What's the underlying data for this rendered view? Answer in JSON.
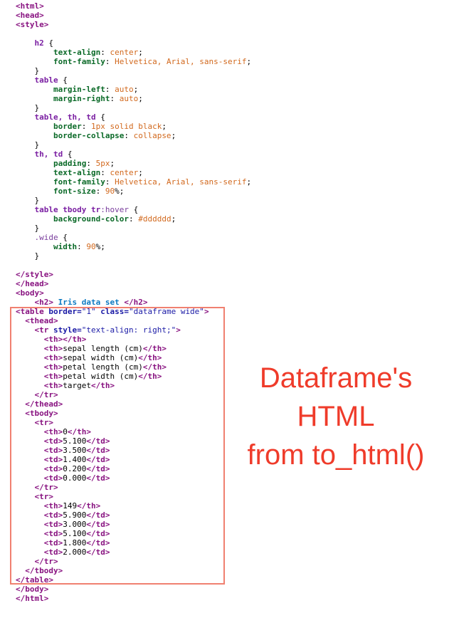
{
  "code_lines": [
    [
      {
        "t": "tag",
        "v": "<html>"
      }
    ],
    [
      {
        "t": "tag",
        "v": "<head>"
      }
    ],
    [
      {
        "t": "tag",
        "v": "<style>"
      }
    ],
    [],
    [
      {
        "t": "text",
        "v": "    "
      },
      {
        "t": "sel",
        "v": "h2"
      },
      {
        "t": "text",
        "v": " {"
      }
    ],
    [
      {
        "t": "text",
        "v": "        "
      },
      {
        "t": "prop",
        "v": "text-align"
      },
      {
        "t": "text",
        "v": ": "
      },
      {
        "t": "val",
        "v": "center"
      },
      {
        "t": "text",
        "v": ";"
      }
    ],
    [
      {
        "t": "text",
        "v": "        "
      },
      {
        "t": "prop",
        "v": "font-family"
      },
      {
        "t": "text",
        "v": ": "
      },
      {
        "t": "val",
        "v": "Helvetica, Arial, sans-serif"
      },
      {
        "t": "text",
        "v": ";"
      }
    ],
    [
      {
        "t": "text",
        "v": "    }"
      }
    ],
    [
      {
        "t": "text",
        "v": "    "
      },
      {
        "t": "sel",
        "v": "table"
      },
      {
        "t": "text",
        "v": " {"
      }
    ],
    [
      {
        "t": "text",
        "v": "        "
      },
      {
        "t": "prop",
        "v": "margin-left"
      },
      {
        "t": "text",
        "v": ": "
      },
      {
        "t": "val",
        "v": "auto"
      },
      {
        "t": "text",
        "v": ";"
      }
    ],
    [
      {
        "t": "text",
        "v": "        "
      },
      {
        "t": "prop",
        "v": "margin-right"
      },
      {
        "t": "text",
        "v": ": "
      },
      {
        "t": "val",
        "v": "auto"
      },
      {
        "t": "text",
        "v": ";"
      }
    ],
    [
      {
        "t": "text",
        "v": "    }"
      }
    ],
    [
      {
        "t": "text",
        "v": "    "
      },
      {
        "t": "sel",
        "v": "table, th, td"
      },
      {
        "t": "text",
        "v": " {"
      }
    ],
    [
      {
        "t": "text",
        "v": "        "
      },
      {
        "t": "prop",
        "v": "border"
      },
      {
        "t": "text",
        "v": ": "
      },
      {
        "t": "val",
        "v": "1px solid black"
      },
      {
        "t": "text",
        "v": ";"
      }
    ],
    [
      {
        "t": "text",
        "v": "        "
      },
      {
        "t": "prop",
        "v": "border-collapse"
      },
      {
        "t": "text",
        "v": ": "
      },
      {
        "t": "val",
        "v": "collapse"
      },
      {
        "t": "text",
        "v": ";"
      }
    ],
    [
      {
        "t": "text",
        "v": "    }"
      }
    ],
    [
      {
        "t": "text",
        "v": "    "
      },
      {
        "t": "sel",
        "v": "th, td"
      },
      {
        "t": "text",
        "v": " {"
      }
    ],
    [
      {
        "t": "text",
        "v": "        "
      },
      {
        "t": "prop",
        "v": "padding"
      },
      {
        "t": "text",
        "v": ": "
      },
      {
        "t": "val",
        "v": "5px"
      },
      {
        "t": "text",
        "v": ";"
      }
    ],
    [
      {
        "t": "text",
        "v": "        "
      },
      {
        "t": "prop",
        "v": "text-align"
      },
      {
        "t": "text",
        "v": ": "
      },
      {
        "t": "val",
        "v": "center"
      },
      {
        "t": "text",
        "v": ";"
      }
    ],
    [
      {
        "t": "text",
        "v": "        "
      },
      {
        "t": "prop",
        "v": "font-family"
      },
      {
        "t": "text",
        "v": ": "
      },
      {
        "t": "val",
        "v": "Helvetica, Arial, sans-serif"
      },
      {
        "t": "text",
        "v": ";"
      }
    ],
    [
      {
        "t": "text",
        "v": "        "
      },
      {
        "t": "prop",
        "v": "font-size"
      },
      {
        "t": "text",
        "v": ": "
      },
      {
        "t": "val",
        "v": "90"
      },
      {
        "t": "text",
        "v": "%;"
      }
    ],
    [
      {
        "t": "text",
        "v": "    }"
      }
    ],
    [
      {
        "t": "text",
        "v": "    "
      },
      {
        "t": "sel",
        "v": "table tbody tr"
      },
      {
        "t": "pseudo",
        "v": ":hover"
      },
      {
        "t": "text",
        "v": " {"
      }
    ],
    [
      {
        "t": "text",
        "v": "        "
      },
      {
        "t": "prop",
        "v": "background-color"
      },
      {
        "t": "text",
        "v": ": "
      },
      {
        "t": "val",
        "v": "#dddddd"
      },
      {
        "t": "text",
        "v": ";"
      }
    ],
    [
      {
        "t": "text",
        "v": "    }"
      }
    ],
    [
      {
        "t": "text",
        "v": "    "
      },
      {
        "t": "pseudo",
        "v": ".wide"
      },
      {
        "t": "text",
        "v": " {"
      }
    ],
    [
      {
        "t": "text",
        "v": "        "
      },
      {
        "t": "prop",
        "v": "width"
      },
      {
        "t": "text",
        "v": ": "
      },
      {
        "t": "val",
        "v": "90"
      },
      {
        "t": "text",
        "v": "%;"
      }
    ],
    [
      {
        "t": "text",
        "v": "    }"
      }
    ],
    [],
    [
      {
        "t": "tag",
        "v": "</style>"
      }
    ],
    [
      {
        "t": "tag",
        "v": "</head>"
      }
    ],
    [
      {
        "t": "tag",
        "v": "<body>"
      }
    ],
    [
      {
        "t": "text",
        "v": "    "
      },
      {
        "t": "tag",
        "v": "<h2>"
      },
      {
        "t": "title",
        "v": " Iris data set "
      },
      {
        "t": "tag",
        "v": "</h2>"
      }
    ],
    [
      {
        "t": "tag",
        "v": "<table "
      },
      {
        "t": "attr",
        "v": "border="
      },
      {
        "t": "str",
        "v": "\"1\""
      },
      {
        "t": "text",
        "v": " "
      },
      {
        "t": "attr",
        "v": "class="
      },
      {
        "t": "str",
        "v": "\"dataframe wide\""
      },
      {
        "t": "tag",
        "v": ">"
      }
    ],
    [
      {
        "t": "text",
        "v": "  "
      },
      {
        "t": "tag",
        "v": "<thead>"
      }
    ],
    [
      {
        "t": "text",
        "v": "    "
      },
      {
        "t": "tag",
        "v": "<tr "
      },
      {
        "t": "attr",
        "v": "style="
      },
      {
        "t": "str",
        "v": "\"text-align: right;\""
      },
      {
        "t": "tag",
        "v": ">"
      }
    ],
    [
      {
        "t": "text",
        "v": "      "
      },
      {
        "t": "tag",
        "v": "<th></th>"
      }
    ],
    [
      {
        "t": "text",
        "v": "      "
      },
      {
        "t": "tag",
        "v": "<th>"
      },
      {
        "t": "text",
        "v": "sepal length (cm)"
      },
      {
        "t": "tag",
        "v": "</th>"
      }
    ],
    [
      {
        "t": "text",
        "v": "      "
      },
      {
        "t": "tag",
        "v": "<th>"
      },
      {
        "t": "text",
        "v": "sepal width (cm)"
      },
      {
        "t": "tag",
        "v": "</th>"
      }
    ],
    [
      {
        "t": "text",
        "v": "      "
      },
      {
        "t": "tag",
        "v": "<th>"
      },
      {
        "t": "text",
        "v": "petal length (cm)"
      },
      {
        "t": "tag",
        "v": "</th>"
      }
    ],
    [
      {
        "t": "text",
        "v": "      "
      },
      {
        "t": "tag",
        "v": "<th>"
      },
      {
        "t": "text",
        "v": "petal width (cm)"
      },
      {
        "t": "tag",
        "v": "</th>"
      }
    ],
    [
      {
        "t": "text",
        "v": "      "
      },
      {
        "t": "tag",
        "v": "<th>"
      },
      {
        "t": "text",
        "v": "target"
      },
      {
        "t": "tag",
        "v": "</th>"
      }
    ],
    [
      {
        "t": "text",
        "v": "    "
      },
      {
        "t": "tag",
        "v": "</tr>"
      }
    ],
    [
      {
        "t": "text",
        "v": "  "
      },
      {
        "t": "tag",
        "v": "</thead>"
      }
    ],
    [
      {
        "t": "text",
        "v": "  "
      },
      {
        "t": "tag",
        "v": "<tbody>"
      }
    ],
    [
      {
        "t": "text",
        "v": "    "
      },
      {
        "t": "tag",
        "v": "<tr>"
      }
    ],
    [
      {
        "t": "text",
        "v": "      "
      },
      {
        "t": "tag",
        "v": "<th>"
      },
      {
        "t": "text",
        "v": "0"
      },
      {
        "t": "tag",
        "v": "</th>"
      }
    ],
    [
      {
        "t": "text",
        "v": "      "
      },
      {
        "t": "tag",
        "v": "<td>"
      },
      {
        "t": "text",
        "v": "5.100"
      },
      {
        "t": "tag",
        "v": "</td>"
      }
    ],
    [
      {
        "t": "text",
        "v": "      "
      },
      {
        "t": "tag",
        "v": "<td>"
      },
      {
        "t": "text",
        "v": "3.500"
      },
      {
        "t": "tag",
        "v": "</td>"
      }
    ],
    [
      {
        "t": "text",
        "v": "      "
      },
      {
        "t": "tag",
        "v": "<td>"
      },
      {
        "t": "text",
        "v": "1.400"
      },
      {
        "t": "tag",
        "v": "</td>"
      }
    ],
    [
      {
        "t": "text",
        "v": "      "
      },
      {
        "t": "tag",
        "v": "<td>"
      },
      {
        "t": "text",
        "v": "0.200"
      },
      {
        "t": "tag",
        "v": "</td>"
      }
    ],
    [
      {
        "t": "text",
        "v": "      "
      },
      {
        "t": "tag",
        "v": "<td>"
      },
      {
        "t": "text",
        "v": "0.000"
      },
      {
        "t": "tag",
        "v": "</td>"
      }
    ],
    [
      {
        "t": "text",
        "v": "    "
      },
      {
        "t": "tag",
        "v": "</tr>"
      }
    ],
    [
      {
        "t": "text",
        "v": "    "
      },
      {
        "t": "tag",
        "v": "<tr>"
      }
    ],
    [
      {
        "t": "text",
        "v": "      "
      },
      {
        "t": "tag",
        "v": "<th>"
      },
      {
        "t": "text",
        "v": "149"
      },
      {
        "t": "tag",
        "v": "</th>"
      }
    ],
    [
      {
        "t": "text",
        "v": "      "
      },
      {
        "t": "tag",
        "v": "<td>"
      },
      {
        "t": "text",
        "v": "5.900"
      },
      {
        "t": "tag",
        "v": "</td>"
      }
    ],
    [
      {
        "t": "text",
        "v": "      "
      },
      {
        "t": "tag",
        "v": "<td>"
      },
      {
        "t": "text",
        "v": "3.000"
      },
      {
        "t": "tag",
        "v": "</td>"
      }
    ],
    [
      {
        "t": "text",
        "v": "      "
      },
      {
        "t": "tag",
        "v": "<td>"
      },
      {
        "t": "text",
        "v": "5.100"
      },
      {
        "t": "tag",
        "v": "</td>"
      }
    ],
    [
      {
        "t": "text",
        "v": "      "
      },
      {
        "t": "tag",
        "v": "<td>"
      },
      {
        "t": "text",
        "v": "1.800"
      },
      {
        "t": "tag",
        "v": "</td>"
      }
    ],
    [
      {
        "t": "text",
        "v": "      "
      },
      {
        "t": "tag",
        "v": "<td>"
      },
      {
        "t": "text",
        "v": "2.000"
      },
      {
        "t": "tag",
        "v": "</td>"
      }
    ],
    [
      {
        "t": "text",
        "v": "    "
      },
      {
        "t": "tag",
        "v": "</tr>"
      }
    ],
    [
      {
        "t": "text",
        "v": "  "
      },
      {
        "t": "tag",
        "v": "</tbody>"
      }
    ],
    [
      {
        "t": "tag",
        "v": "</table>"
      }
    ],
    [
      {
        "t": "tag",
        "v": "</body>"
      }
    ],
    [
      {
        "t": "tag",
        "v": "</html>"
      }
    ]
  ],
  "annotation": {
    "line1": "Dataframe's",
    "line2": "HTML",
    "line3": "from to_html()",
    "color": "#ef3b2a"
  },
  "highlight_color": "#f08070"
}
